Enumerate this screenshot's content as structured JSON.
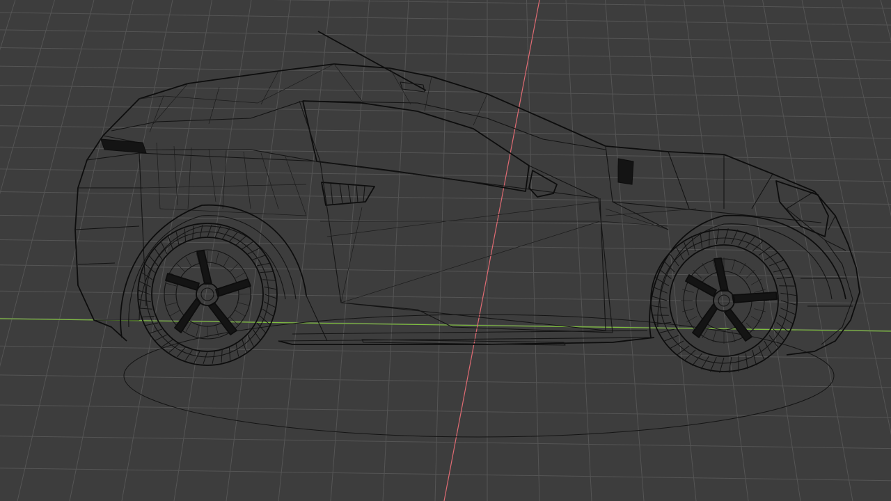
{
  "viewport": {
    "background": "#3d3d3d",
    "grid_color": "#555555",
    "axis_x_color": "#7fbf3f",
    "axis_y_color": "#e06b73",
    "wire_color": "#141414",
    "overlay": "wireframe"
  },
  "scene": {
    "object": "car-body",
    "front_wheel": "wheel",
    "rear_wheel": "wheel",
    "ground_shadow": "ellipse"
  }
}
